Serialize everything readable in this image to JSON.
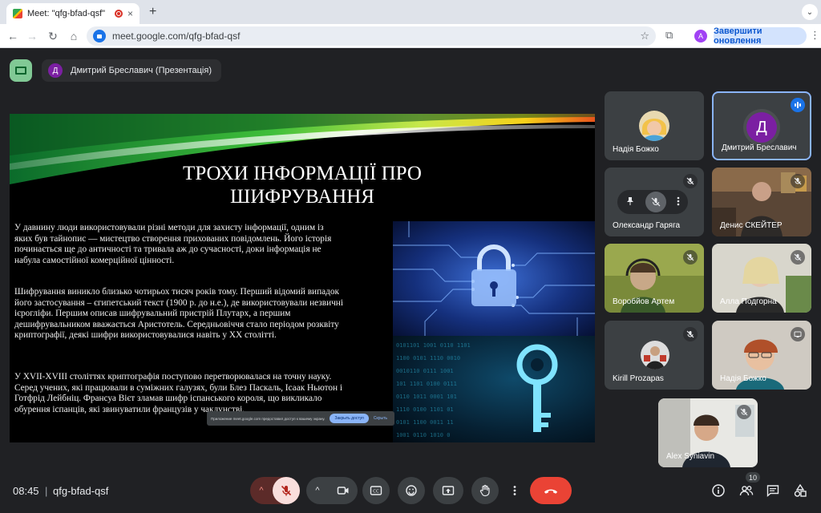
{
  "browser": {
    "tab_title": "Meet: \"qfg-bfad-qsf\"",
    "tab_close": "×",
    "new_tab": "+",
    "tabs_dropdown": "⌄",
    "url": "meet.google.com/qfg-bfad-qsf",
    "profile_letter": "A",
    "update_button": "Завершити оновлення",
    "nav": {
      "back": "←",
      "forward": "→",
      "reload": "↻",
      "home": "⌂"
    },
    "bookmark": "☆",
    "extensions": "⧉",
    "menu": "⋮"
  },
  "header": {
    "presenter_initial": "Д",
    "presenter_label": "Дмитрий Бреславич (Презентація)"
  },
  "slide": {
    "title_line1": "ТРОХИ ІНФОРМАЦІЇ ПРО",
    "title_line2": "ШИФРУВАННЯ",
    "paragraph1": "У давнину люди використовували різні методи для захисту інформації, одним із яких був тайнопис — мистецтво створення прихованих повідомлень. Його історія починається ще до античності та тривала аж до сучасності, доки інформація не набула самостійної комерційної цінності.",
    "paragraph2": "Шифрування виникло близько чотирьох тисяч років тому. Перший відомий випадок його застосування – єгипетський текст (1900 р. до н.е.), де використовували незвичні ієрогліфи. Першим описав шифрувальний пристрій Плутарх, а першим дешифрувальником вважається Аристотель. Середньовіччя стало періодом розквіту криптографії, деякі шифри використовувалися навіть у XX столітті.",
    "paragraph3": "У XVII-XVIII століттях криптографія поступово перетворювалася на точну науку. Серед учених, які працювали в суміжних галузях, були Блез Паскаль, Ісаак Ньютон і Готфрід Лейбніц. Франсуа Вієт зламав шифр іспанського короля, що викликало обурення іспанців, які звинуватили французів у чаклунстві.",
    "share_notice": "Приложение meet.google.com предоставил доступ к вашему экрану.",
    "share_stop": "Закрыть доступ",
    "share_hide": "Скрыть"
  },
  "participants": [
    {
      "name": "Надія Божко",
      "muted": false
    },
    {
      "name": "Дмитрий Бреславич",
      "initial": "Д",
      "speaking": true
    },
    {
      "name": "Олександр Гаряга",
      "muted": true
    },
    {
      "name": "Денис СКЕЙТЕР",
      "muted": true
    },
    {
      "name": "Воробйов Артем",
      "muted": true
    },
    {
      "name": "Алла Подгорна",
      "muted": true
    },
    {
      "name": "Kirill Prozapas",
      "muted": true
    },
    {
      "name": "Надія Божко",
      "presenting": true
    },
    {
      "name": "Alex Syniavin",
      "muted": true
    }
  ],
  "hover_controls": {
    "pin": "pin-icon",
    "mute": "mic-off-icon",
    "more": "more-vert-icon"
  },
  "footer": {
    "time": "08:45",
    "separator": "|",
    "meeting_code": "qfg-bfad-qsf",
    "people_count": "10",
    "caret": "^"
  },
  "colors": {
    "accent": "#8ab4f8",
    "end_call": "#ea4335",
    "mic_off_bg": "#f9dedc",
    "presenter_avatar": "#7b1fa2"
  }
}
